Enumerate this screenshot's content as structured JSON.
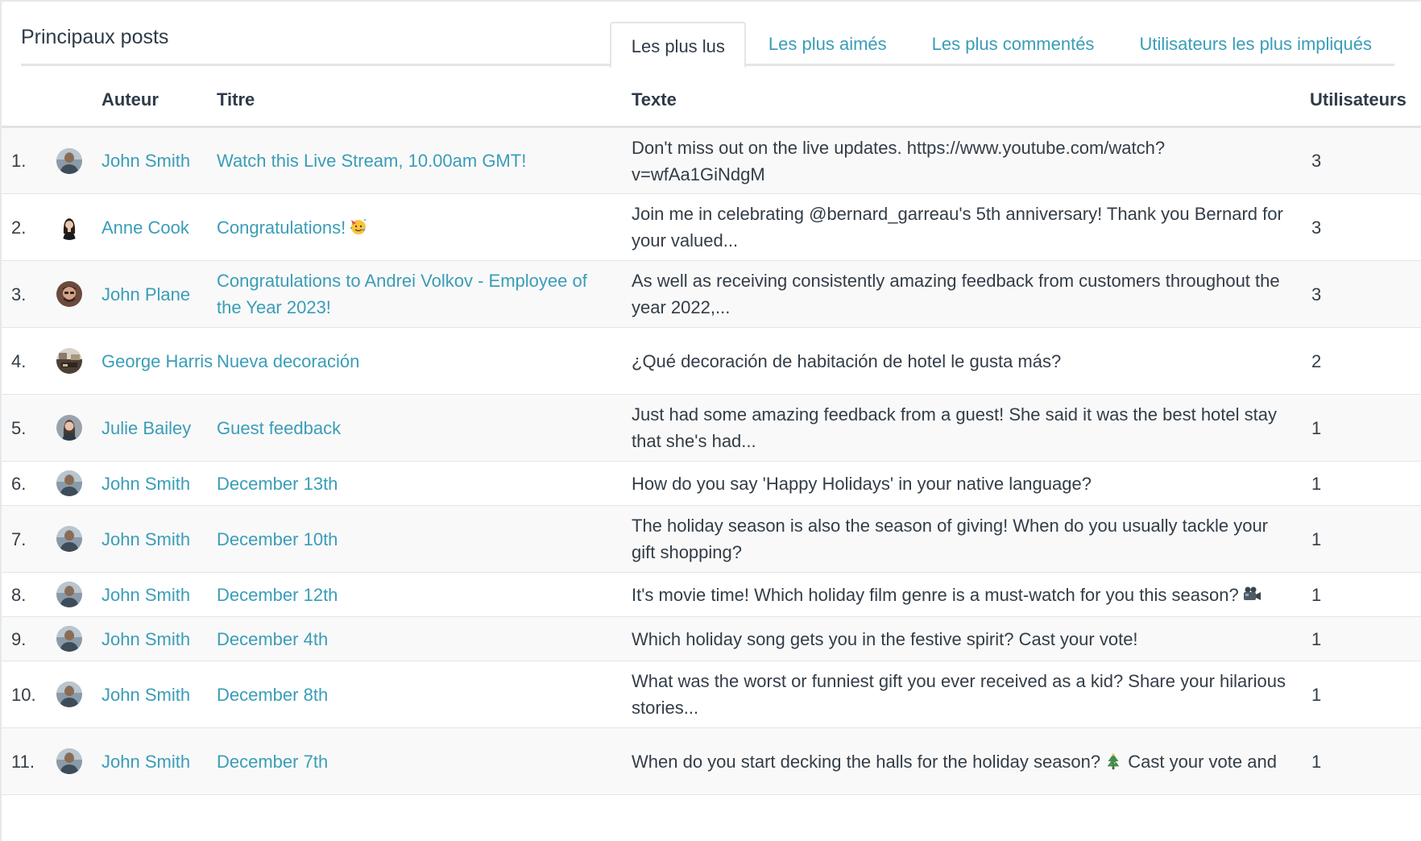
{
  "panel": {
    "title": "Principaux posts",
    "tabs": [
      {
        "label": "Les plus lus",
        "active": true
      },
      {
        "label": "Les plus aimés",
        "active": false
      },
      {
        "label": "Les plus commentés",
        "active": false
      },
      {
        "label": "Utilisateurs les plus impliqués",
        "active": false
      }
    ]
  },
  "table": {
    "columns": {
      "author": "Auteur",
      "title": "Titre",
      "text": "Texte",
      "users": "Utilisateurs"
    },
    "rows": [
      {
        "num": "1.",
        "author": "John Smith",
        "avatar": "avatar-john-smith",
        "title": "Watch this Live Stream, 10.00am GMT!",
        "text": "Don't miss out on the live updates. https://www.youtube.com/watch?v=wfAa1GiNdgM",
        "users": "3"
      },
      {
        "num": "2.",
        "author": "Anne Cook",
        "avatar": "avatar-anne-cook",
        "title": "Congratulations!",
        "title_emoji": "partying-face-emoji",
        "text": "Join me in celebrating @bernard_garreau's 5th anniversary! Thank you Bernard for your valued...",
        "users": "3"
      },
      {
        "num": "3.",
        "author": "John Plane",
        "avatar": "avatar-john-plane",
        "title": "Congratulations to Andrei Volkov - Employee of the Year 2023!",
        "text": "As well as receiving consistently amazing feedback from customers throughout the year 2022,...",
        "users": "3"
      },
      {
        "num": "4.",
        "author": "George Harris",
        "avatar": "avatar-george-harris",
        "title": "Nueva decoración",
        "text": "¿Qué decoración de habitación de hotel le gusta más?",
        "users": "2"
      },
      {
        "num": "5.",
        "author": "Julie Bailey",
        "avatar": "avatar-julie-bailey",
        "title": "Guest feedback",
        "text": "Just had some amazing feedback from a guest! She said it was the best hotel stay that she's had...",
        "users": "1"
      },
      {
        "num": "6.",
        "author": "John Smith",
        "avatar": "avatar-john-smith",
        "title": "December 13th",
        "text": "How do you say 'Happy Holidays' in your native language?",
        "users": "1"
      },
      {
        "num": "7.",
        "author": "John Smith",
        "avatar": "avatar-john-smith",
        "title": "December 10th",
        "text": "The holiday season is also the season of giving! When do you usually tackle your gift shopping?",
        "users": "1"
      },
      {
        "num": "8.",
        "author": "John Smith",
        "avatar": "avatar-john-smith",
        "title": "December 12th",
        "text": "It's movie time! Which holiday film genre is a must-watch for you this season?",
        "text_emoji": "movie-camera-emoji",
        "users": "1"
      },
      {
        "num": "9.",
        "author": "John Smith",
        "avatar": "avatar-john-smith",
        "title": "December 4th",
        "text": "Which holiday song gets you in the festive spirit? Cast your vote!",
        "users": "1"
      },
      {
        "num": "10.",
        "author": "John Smith",
        "avatar": "avatar-john-smith",
        "title": "December 8th",
        "text": "What was the worst or funniest gift you ever received as a kid? Share your hilarious stories...",
        "users": "1"
      },
      {
        "num": "11.",
        "author": "John Smith",
        "avatar": "avatar-john-smith",
        "title": "December 7th",
        "text": "When do you start decking the halls for the holiday season?",
        "text_emoji": "christmas-tree-emoji",
        "text_after": "Cast your vote and",
        "users": "1"
      }
    ]
  },
  "colors": {
    "link": "#3a9db8",
    "text": "#333d47",
    "heading": "#2f3b48",
    "row_alt": "#f9f9f9",
    "border": "#e3e5e7"
  }
}
